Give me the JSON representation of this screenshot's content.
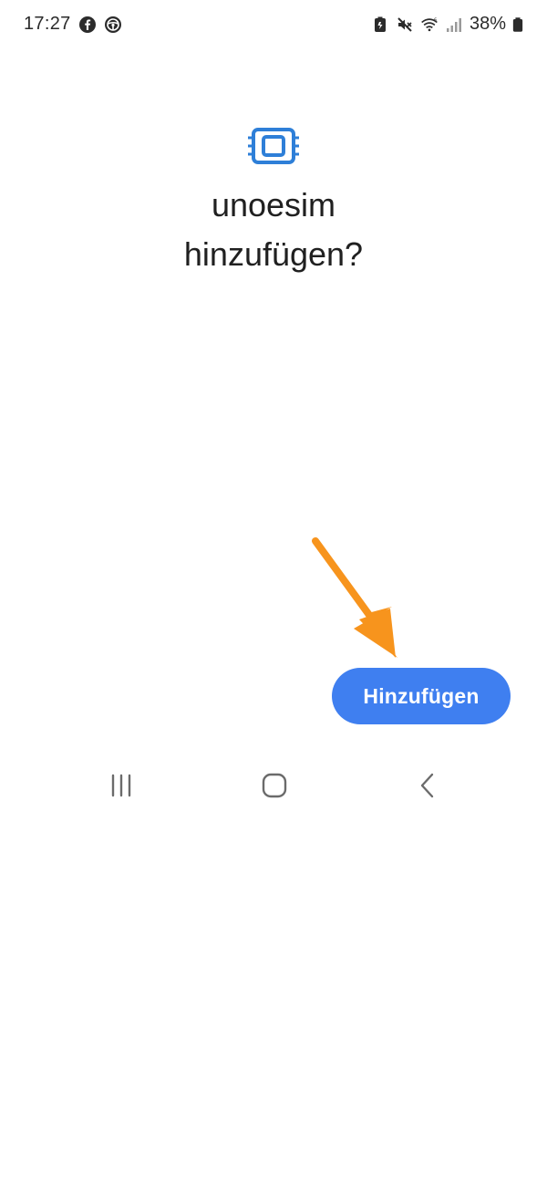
{
  "status_bar": {
    "time": "17:27",
    "battery_percent": "38%",
    "left_icons": [
      "facebook-icon",
      "steering-wheel-icon"
    ],
    "right_icons": [
      "battery-saver-icon",
      "mute-icon",
      "wifi-icon",
      "signal-icon",
      "battery-icon"
    ]
  },
  "dialog": {
    "icon": "esim-card-icon",
    "title_line1": "unoesim",
    "title_line2": "hinzufügen?",
    "add_button_label": "Hinzufügen"
  },
  "annotation": {
    "arrow_icon": "arrow-down-right-icon",
    "color": "#f7941d"
  },
  "nav_bar": {
    "items": [
      "recents-icon",
      "home-icon",
      "back-icon"
    ]
  },
  "colors": {
    "accent": "#3f7ff0",
    "esim_icon": "#2e7fd8",
    "text": "#202020"
  }
}
